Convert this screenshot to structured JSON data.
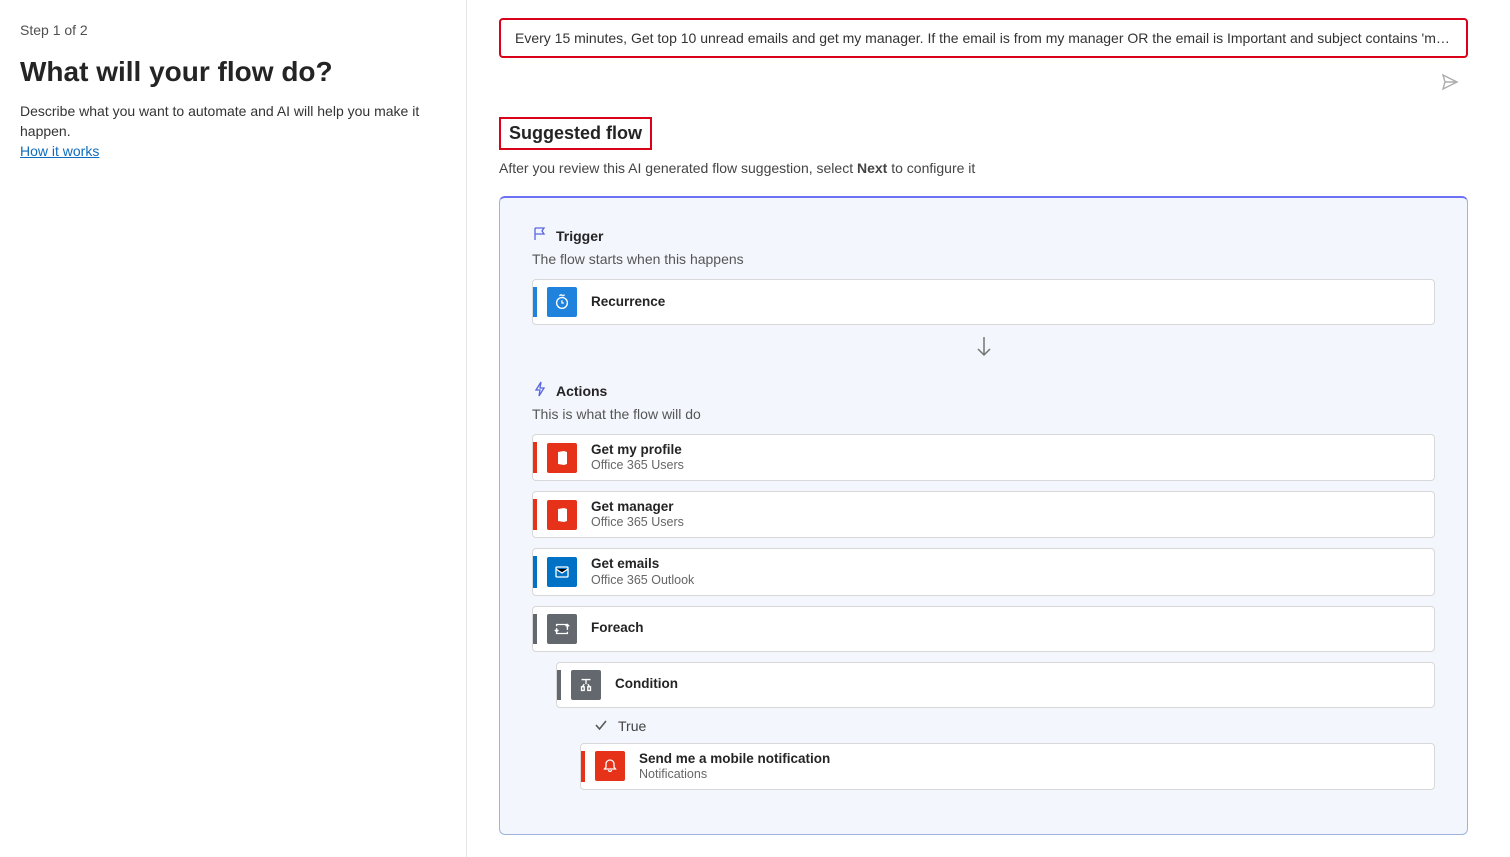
{
  "left": {
    "step": "Step 1 of 2",
    "title": "What will your flow do?",
    "description": "Describe what you want to automate and AI will help you make it happen.",
    "how_it_works": "How it works"
  },
  "prompt": {
    "text": "Every 15 minutes, Get top 10 unread emails and get my manager. If the email is from my manager OR the email is Important and subject contains 'mee..."
  },
  "suggested": {
    "heading": "Suggested flow",
    "desc_before": "After you review this AI generated flow suggestion, select ",
    "desc_bold": "Next",
    "desc_after": " to configure it"
  },
  "trigger": {
    "heading": "Trigger",
    "sub": "The flow starts when this happens",
    "item": {
      "title": "Recurrence",
      "color": "#1f83de"
    }
  },
  "actions": {
    "heading": "Actions",
    "sub": "This is what the flow will do",
    "items": [
      {
        "title": "Get my profile",
        "subtitle": "Office 365 Users",
        "color": "#e53219"
      },
      {
        "title": "Get manager",
        "subtitle": "Office 365 Users",
        "color": "#e53219"
      },
      {
        "title": "Get emails",
        "subtitle": "Office 365 Outlook",
        "color": "#0072c6"
      },
      {
        "title": "Foreach",
        "subtitle": "",
        "color": "#62686e"
      }
    ],
    "condition": {
      "title": "Condition",
      "color": "#62686e"
    },
    "true_label": "True",
    "notify": {
      "title": "Send me a mobile notification",
      "subtitle": "Notifications",
      "color": "#e53219"
    }
  }
}
